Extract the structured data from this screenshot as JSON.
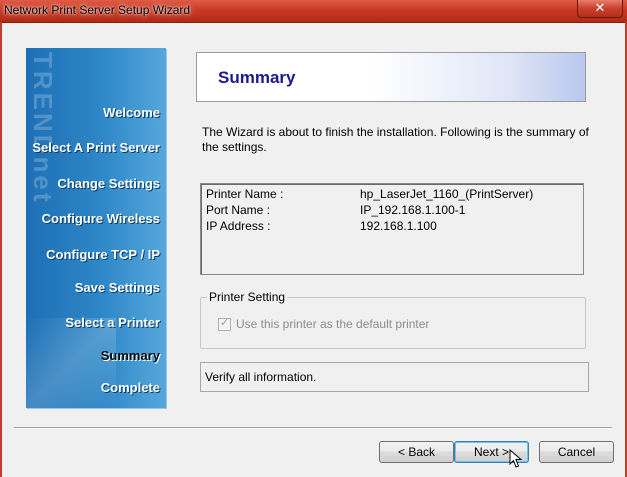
{
  "window": {
    "title": "Network Print Server Setup Wizard",
    "close_label": "✕"
  },
  "sidebar": {
    "logo_text": "TRENDnet",
    "steps": [
      {
        "label": "Welcome",
        "current": false
      },
      {
        "label": "Select A Print Server",
        "current": false
      },
      {
        "label": "Change Settings",
        "current": false
      },
      {
        "label": "Configure Wireless",
        "current": false
      },
      {
        "label": "Configure TCP / IP",
        "current": false
      },
      {
        "label": "Save Settings",
        "current": false
      },
      {
        "label": "Select a Printer",
        "current": false
      },
      {
        "label": "Summary",
        "current": true
      },
      {
        "label": "Complete",
        "current": false
      }
    ]
  },
  "main": {
    "header_title": "Summary",
    "intro_text": "The Wizard is about to finish the installation. Following is the summary of the settings.",
    "info": [
      {
        "label": "Printer Name :",
        "value": "hp_LaserJet_1160_(PrintServer)"
      },
      {
        "label": "Port Name :",
        "value": "IP_192.168.1.100-1"
      },
      {
        "label": "IP Address :",
        "value": "192.168.1.100"
      }
    ],
    "printer_setting": {
      "group_label": "Printer Setting",
      "checkbox_label": "Use this printer as the default printer",
      "checked": true,
      "enabled": false
    },
    "status_text": "Verify all information."
  },
  "buttons": {
    "back_label": "< Back",
    "next_label": "Next >",
    "cancel_label": "Cancel"
  },
  "colors": {
    "titlebar": "#c93a24",
    "sidebar": "#2f88c7",
    "header_title": "#1b1b8c"
  }
}
